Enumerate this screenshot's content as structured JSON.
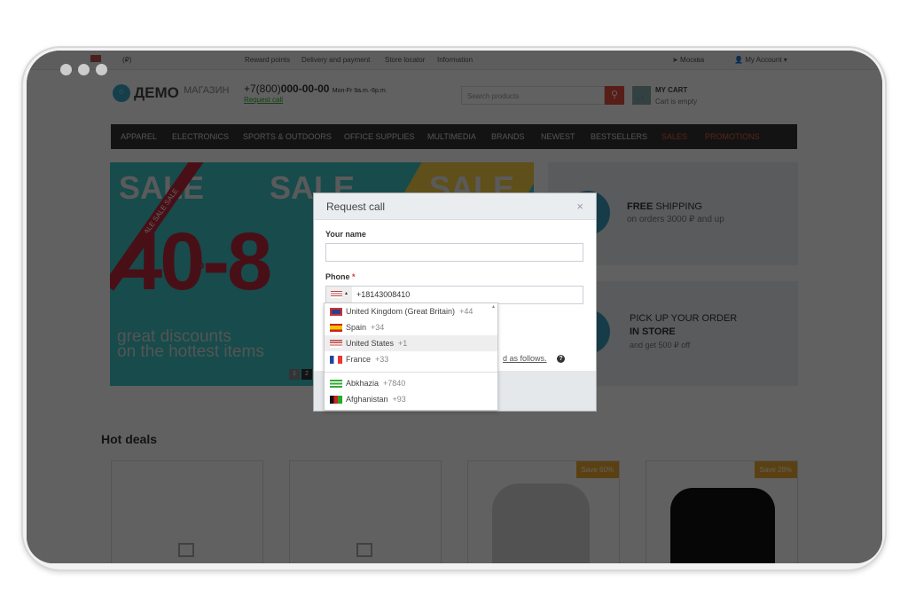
{
  "topbar": {
    "currency": "(₽)",
    "links": [
      "Reward points",
      "Delivery and payment",
      "Store locator",
      "Information"
    ],
    "city": "Москва",
    "account": "My Account"
  },
  "header": {
    "logo_main": "ДЕМО",
    "logo_sub": "МАГАЗИН",
    "phone_prefix": "+7(800)",
    "phone_number": "000-00-00",
    "hours": "Mon-Fr 9a.m.-6p.m.",
    "request_call": "Request call",
    "search_placeholder": "Search products",
    "cart_title": "MY CART",
    "cart_status": "Cart is empty"
  },
  "nav": {
    "items": [
      "APPAREL",
      "ELECTRONICS",
      "SPORTS & OUTDOORS",
      "OFFICE SUPPLIES",
      "MULTIMEDIA",
      "BRANDS",
      "NEWEST",
      "BESTSELLERS",
      "SALES",
      "PROMOTIONS"
    ],
    "accent": "#e8603c"
  },
  "banner": {
    "sale": "SALE",
    "ribbon": "SALE SALE SALE SALE",
    "big": "40-8",
    "percent": "%",
    "line1": "great discounts",
    "line2": "on the hottest items",
    "pages": [
      "1",
      "2"
    ]
  },
  "promos": [
    {
      "bold": "FREE",
      "title": "SHIPPING",
      "sub": "on orders 3000 ₽ and up"
    },
    {
      "title": "PICK UP YOUR ORDER",
      "bold": "IN STORE",
      "sub": "and get 500 ₽ off"
    }
  ],
  "hot_deals": {
    "title": "Hot deals",
    "badges": [
      "Save 60%",
      "Save 28%"
    ]
  },
  "modal": {
    "title": "Request call",
    "close": "×",
    "name_label": "Your name",
    "name_value": "",
    "phone_label": "Phone",
    "required": "*",
    "phone_value": "+18143008410",
    "consent_tail": "d as follows.",
    "help_icon": "?"
  },
  "dropdown": {
    "items": [
      {
        "name": "United Kingdom (Great Britain)",
        "code": "+44"
      },
      {
        "name": "Spain",
        "code": "+34"
      },
      {
        "name": "United States",
        "code": "+1",
        "selected": true
      },
      {
        "name": "France",
        "code": "+33"
      },
      {
        "name": "Abkhazia",
        "code": "+7840"
      },
      {
        "name": "Afghanistan",
        "code": "+93"
      }
    ]
  }
}
